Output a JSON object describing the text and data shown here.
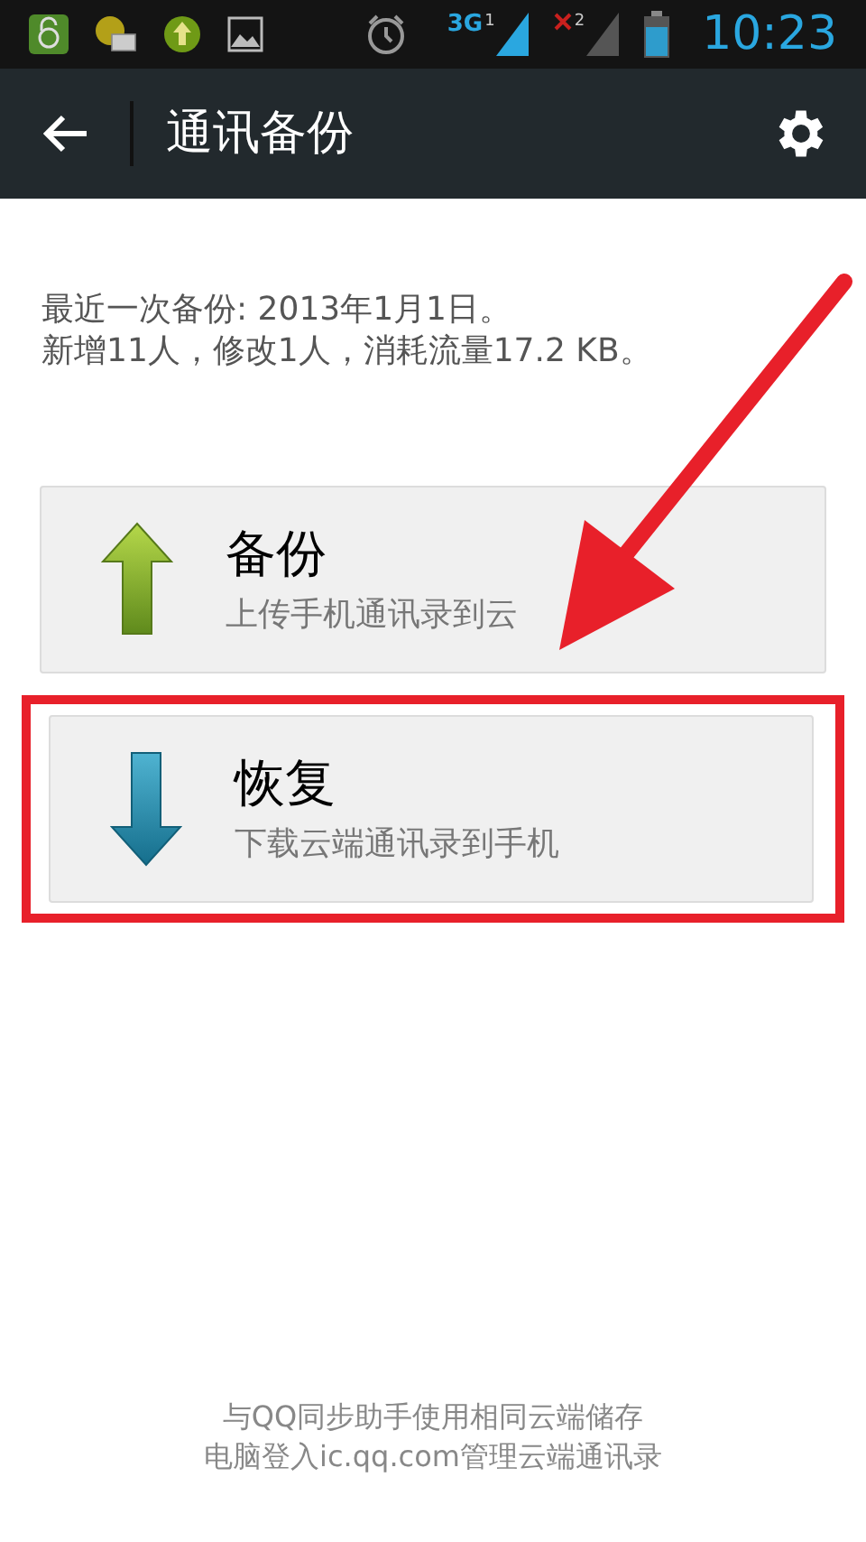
{
  "status_bar": {
    "network": "3G",
    "sim_1": "1",
    "sim_2": "2",
    "time": "10:23"
  },
  "toolbar": {
    "title": "通讯备份"
  },
  "last_backup": {
    "line_1": "最近一次备份: 2013年1月1日。",
    "line_2": "新增11人，修改1人，消耗流量17.2 KB。"
  },
  "actions": [
    {
      "kind": "upload",
      "title": "备份",
      "subtitle": "上传手机通讯录到云",
      "highlighted": false
    },
    {
      "kind": "download",
      "title": "恢复",
      "subtitle": "下载云端通讯录到手机",
      "highlighted": true
    }
  ],
  "footer": {
    "line_1": "与QQ同步助手使用相同云端储存",
    "line_2": "电脑登入ic.qq.com管理云端通讯录"
  }
}
